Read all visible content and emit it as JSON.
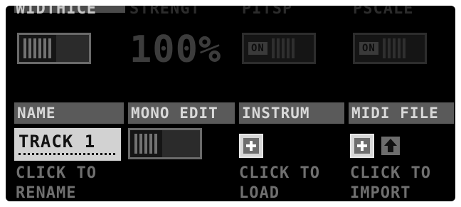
{
  "top_row": {
    "headers": [
      "WIDTHICE",
      "STRENGT",
      "PITSP",
      "PSCALE"
    ],
    "strength_value": "100%",
    "pitch_toggle_label": "ON",
    "scale_toggle_label": "ON"
  },
  "sections": {
    "name": {
      "header": "NAME",
      "value": "TRACK 1",
      "hint_line1": "CLICK TO",
      "hint_line2": "RENAME"
    },
    "mono_edit": {
      "header": "MONO EDIT"
    },
    "instrument": {
      "header": "INSTRUM",
      "hint_line1": "CLICK TO",
      "hint_line2": "LOAD"
    },
    "midi_file": {
      "header": "MIDI FILE",
      "hint_line1": "CLICK TO",
      "hint_line2": "IMPORT"
    }
  },
  "icons": {
    "load_instrument": "plus-icon",
    "import_midi": "plus-icon",
    "upload": "arrow-up-icon"
  },
  "colors": {
    "background": "#000000",
    "header_bg": "#5a5a5a",
    "header_text": "#d8d8d8",
    "field_bg": "#d2d2d2",
    "hint_text": "#6f6f6f"
  }
}
